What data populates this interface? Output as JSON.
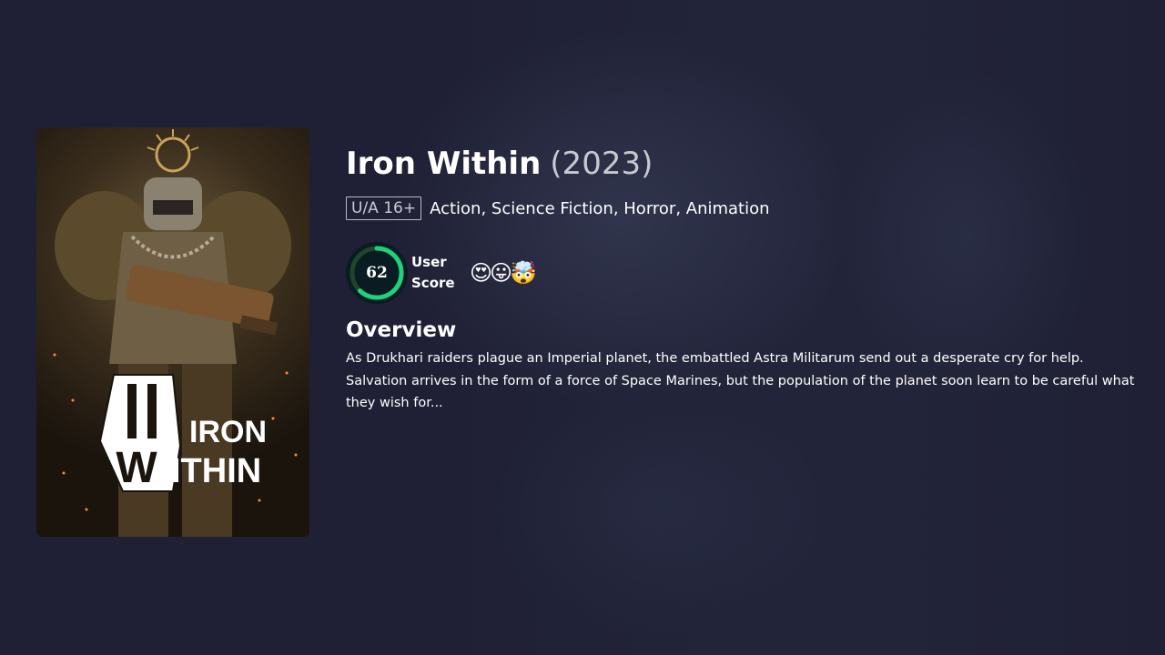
{
  "movie": {
    "title": "Iron Within",
    "year": "(2023)",
    "certification": "U/A 16+",
    "genres": "Action, Science Fiction, Horror, Animation",
    "user_score": "62",
    "user_score_fraction": 0.62,
    "user_score_label": "User Score",
    "reactions": [
      "😍",
      "😛",
      "🤯"
    ],
    "overview_heading": "Overview",
    "overview": "As Drukhari raiders plague an Imperial planet, the embattled Astra Militarum send out a desperate cry for help. Salvation arrives in the form of a force of Space Marines, but the population of the planet soon learn to be careful what they wish for..."
  },
  "poster": {
    "logo_text_top": "IRON",
    "logo_text_bottom": "ITHIN",
    "logo_letter": "W"
  },
  "colors": {
    "background": "#1f2035",
    "score_ring": "#21d07a",
    "score_track": "#204529",
    "score_bg": "#081c22"
  }
}
